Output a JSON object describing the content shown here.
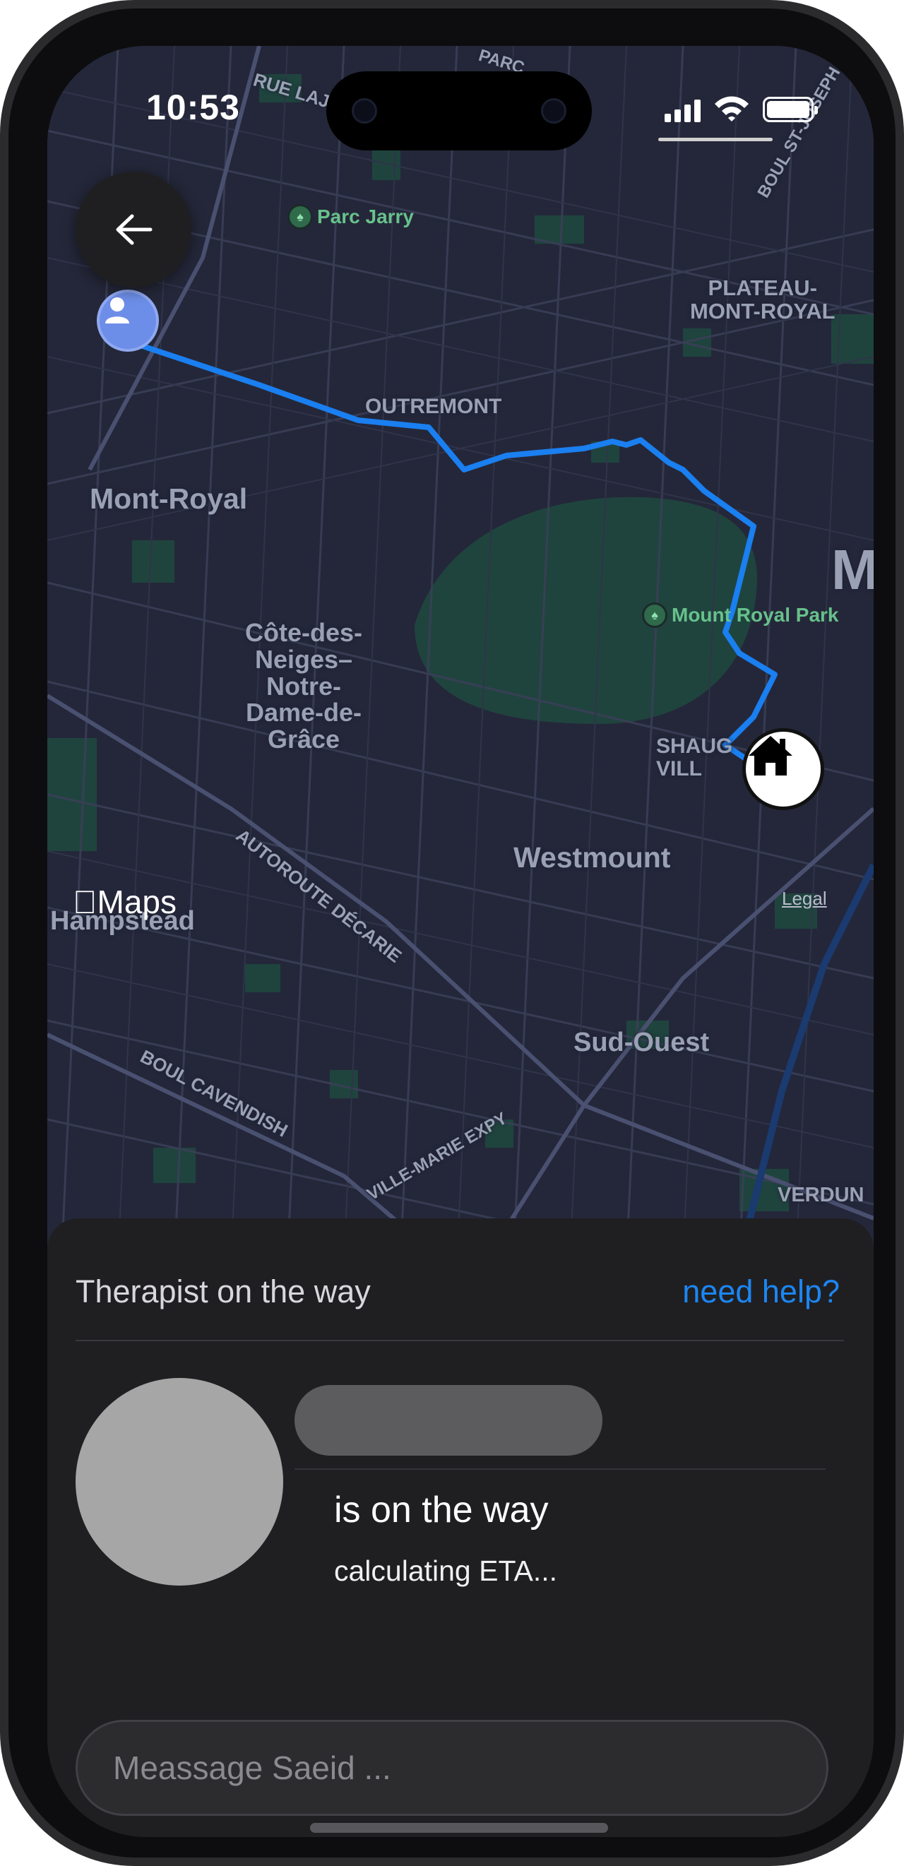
{
  "status_bar": {
    "time": "10:53"
  },
  "map": {
    "labels": {
      "parc_jarry": "Parc Jarry",
      "plateau": "PLATEAU-\nMONT-ROYAL",
      "outremont": "OUTREMONT",
      "mont_royal": "Mont-Royal",
      "cote_des_neiges": "Côte-des-\nNeiges–\nNotre-\nDame-de-\nGrâce",
      "mount_royal_park": "Mount Royal Park",
      "shaughnessy": "SHAUG\nVILL",
      "westmount": "Westmount",
      "hampstead": "Hampstead",
      "sud_ouest": "Sud-Ouest",
      "verdun": "VERDUN",
      "autoroute": "AUTOROUTE DÉCARIE",
      "cavendish": "BOUL CAVENDISH",
      "ville_marie": "VILLE-MARIE EXPY",
      "rue": "RUE LAJ",
      "boul_st_joseph": "BOUL ST-JOSEPH",
      "parc_top": "PARC",
      "m_edge": "M"
    },
    "maps_brand": "Maps",
    "legal": "Legal",
    "colors": {
      "route": "#1a7ff0",
      "park": "#1e4a3e",
      "base": "#23263a"
    }
  },
  "sheet": {
    "title": "Therapist on the way",
    "help_link": "need help?",
    "status": "is on the way",
    "eta": "calculating ETA...",
    "message_placeholder": "Meassage Saeid ..."
  },
  "icons": [
    "back-arrow-icon",
    "user-location-icon",
    "home-icon",
    "park-pin-icon",
    "cellular-signal-icon",
    "wifi-icon",
    "battery-icon",
    "apple-logo-icon"
  ]
}
